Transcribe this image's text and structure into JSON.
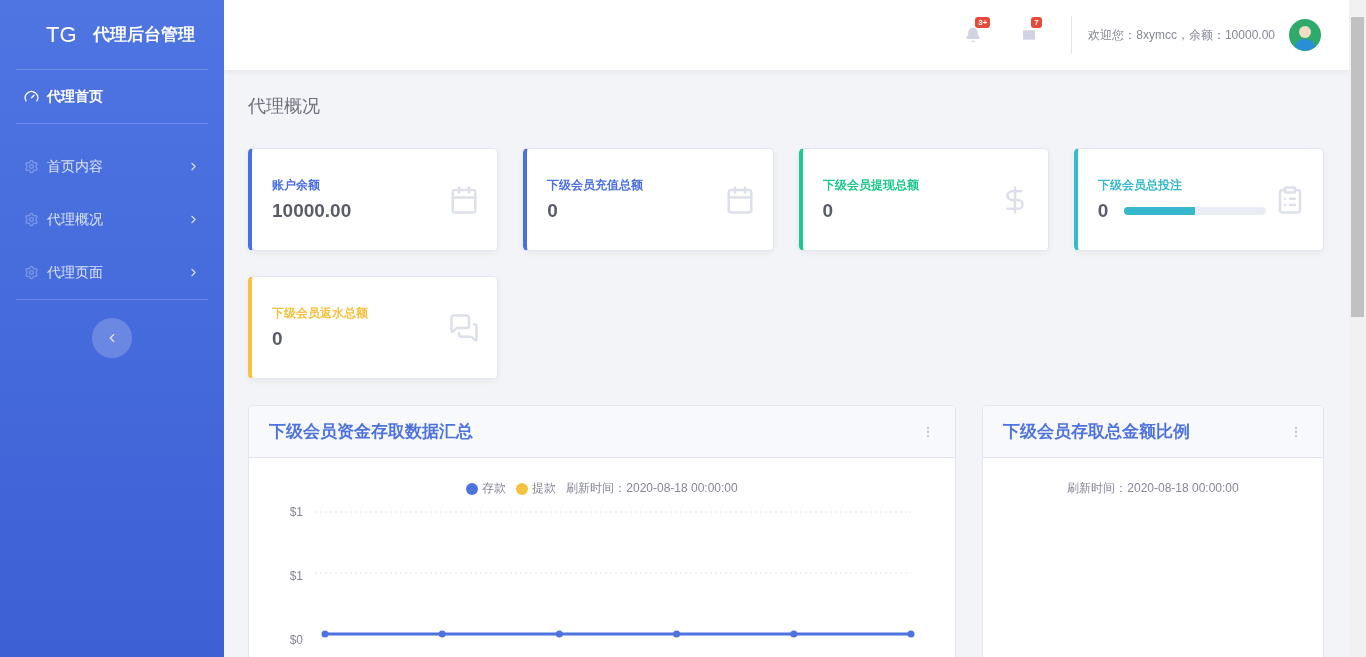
{
  "sidebar": {
    "logo": "TG",
    "title": "代理后台管理",
    "items": [
      {
        "label": "代理首页",
        "kind": "link",
        "selected": true
      },
      {
        "label": "首页内容",
        "kind": "submenu",
        "selected": false
      },
      {
        "label": "代理概况",
        "kind": "submenu",
        "selected": false
      },
      {
        "label": "代理页面",
        "kind": "submenu",
        "selected": false
      }
    ]
  },
  "header": {
    "notification_badge": "3+",
    "message_badge": "7",
    "welcome": "欢迎您：8xymcc，余额：10000.00"
  },
  "page_title": "代理概况",
  "stats": [
    {
      "label": "账户余额",
      "value": "10000.00",
      "color": "#4a6fe3"
    },
    {
      "label": "下级会员充值总额",
      "value": "0",
      "color": "#4a6fe3"
    },
    {
      "label": "下级会员提现总额",
      "value": "0",
      "color": "#1cc88a"
    },
    {
      "label": "下级会员总投注",
      "value": "0",
      "color": "#36b9cc",
      "level": 0.5
    },
    {
      "label": "下级会员返水总额",
      "value": "0",
      "color": "#f6c23e"
    }
  ],
  "panels": [
    {
      "title": "下级会员资金存取数据汇总",
      "legend": [
        {
          "label": "存款",
          "color": "#4e73df"
        },
        {
          "label": "提款",
          "color": "#f6c23e"
        }
      ],
      "refresh": "刷新时间：2020-08-18 00:00:00",
      "y_labels": [
        "$1",
        "$1",
        "$0"
      ]
    },
    {
      "title": "下级会员存取总金额比例",
      "refresh": "刷新时间：2020-08-18 00:00:00"
    }
  ]
}
